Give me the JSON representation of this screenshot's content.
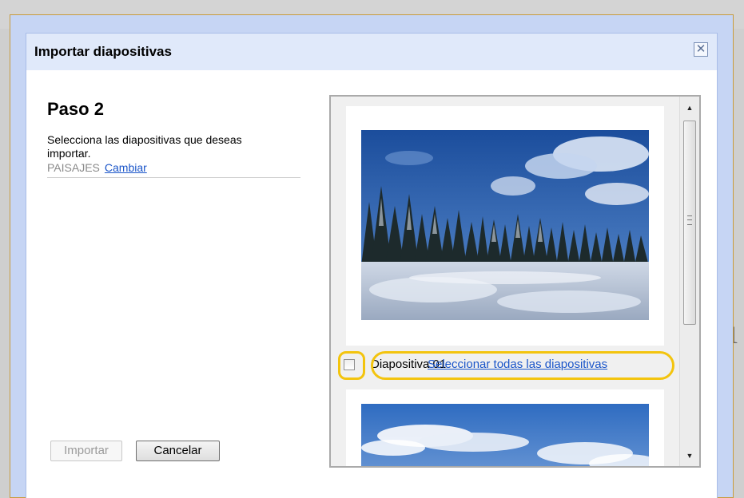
{
  "dialog": {
    "title": "Importar diapositivas",
    "close_icon": "close-icon"
  },
  "step": {
    "title": "Paso 2",
    "description": "Selecciona las diapositivas que deseas importar.",
    "source_name": "PAISAJES",
    "change_link": "Cambiar"
  },
  "buttons": {
    "import_label": "Importar",
    "cancel_label": "Cancelar"
  },
  "slides": [
    {
      "label": "Diapositiva 01",
      "checked": false,
      "thumbnail": "snowy-forest-landscape"
    },
    {
      "thumbnail": "blue-sky-clouds"
    }
  ],
  "select_all_link": "Seleccionar todas las diapositivas",
  "colors": {
    "link": "#1a55c9",
    "title_bar": "#e0e9fa",
    "dialog_frame": "#c6d5f4",
    "highlight": "#f3c40e"
  }
}
